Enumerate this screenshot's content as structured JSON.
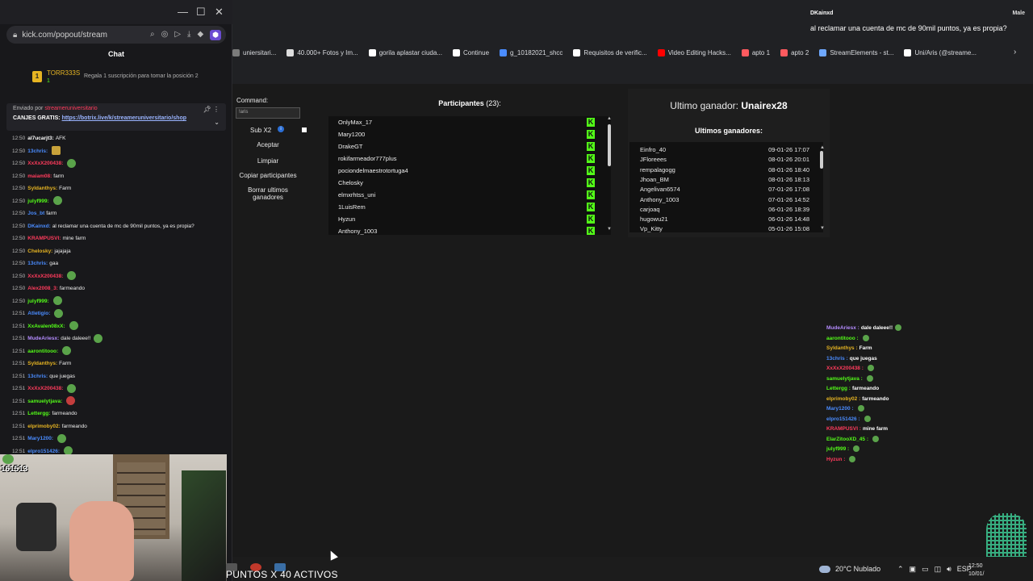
{
  "popout": {
    "url": "kick.com/popout/stream",
    "chat_title": "Chat",
    "leader": {
      "rank": "1",
      "name": "TORR333S",
      "sub": "1",
      "promo": "Regala 1 suscripción para tomar la posición 2"
    },
    "pinned": {
      "prefix": "Enviado por",
      "pinner": "streameruniversitario",
      "text": "CANJES GRATIS:",
      "link": "https://botrix.live/k/streameruniversitario/shop"
    },
    "messages": [
      {
        "t": "12:50",
        "u": "al7ucarjt3:",
        "c": "#ffffff",
        "m": "AFK",
        "e": ""
      },
      {
        "t": "12:50",
        "u": "13chris:",
        "c": "#4a8cff",
        "m": "",
        "e": "gold"
      },
      {
        "t": "12:50",
        "u": "XxXxX200438:",
        "c": "#ff3b5c",
        "m": "",
        "e": "pepe"
      },
      {
        "t": "12:50",
        "u": "maiam08:",
        "c": "#ff3b5c",
        "m": "farm",
        "e": ""
      },
      {
        "t": "12:50",
        "u": "Syldanthys:",
        "c": "#e6b422",
        "m": "Farm",
        "e": ""
      },
      {
        "t": "12:50",
        "u": "julyf999:",
        "c": "#53fc18",
        "m": "",
        "e": "pepe"
      },
      {
        "t": "12:50",
        "u": "Jos_bt",
        "c": "#4a8cff",
        "m": "farm",
        "e": ""
      },
      {
        "t": "12:50",
        "u": "DKainxd:",
        "c": "#4a8cff",
        "m": "al reclamar una cuenta de mc de 90mil puntos, ya es propia?",
        "e": ""
      },
      {
        "t": "12:50",
        "u": "KRAMPUSVI:",
        "c": "#ff3b5c",
        "m": "mine farm",
        "e": ""
      },
      {
        "t": "12:50",
        "u": "Chelosky:",
        "c": "#e6b422",
        "m": "jajajaja",
        "e": ""
      },
      {
        "t": "12:50",
        "u": "13chris:",
        "c": "#4a8cff",
        "m": "gaa",
        "e": ""
      },
      {
        "t": "12:50",
        "u": "XxXxX200438:",
        "c": "#ff3b5c",
        "m": "",
        "e": "pepe"
      },
      {
        "t": "12:50",
        "u": "Alex2008_3:",
        "c": "#ff3b5c",
        "m": "farmeando",
        "e": ""
      },
      {
        "t": "12:50",
        "u": "julyf999:",
        "c": "#53fc18",
        "m": "",
        "e": "pepe"
      },
      {
        "t": "12:51",
        "u": "Atletigio:",
        "c": "#4a8cff",
        "m": "",
        "e": "pepe"
      },
      {
        "t": "12:51",
        "u": "XxAvalen08xX:",
        "c": "#53fc18",
        "m": "",
        "e": "pepe"
      },
      {
        "t": "12:51",
        "u": "MudeAriesx:",
        "c": "#b58cff",
        "m": "dale daleee!!",
        "e": "pepe"
      },
      {
        "t": "12:51",
        "u": "aarontitooo:",
        "c": "#53fc18",
        "m": "",
        "e": "pepe"
      },
      {
        "t": "12:51",
        "u": "Syldanthys:",
        "c": "#e6b422",
        "m": "Farm",
        "e": ""
      },
      {
        "t": "12:51",
        "u": "13chris:",
        "c": "#4a8cff",
        "m": "que juegas",
        "e": ""
      },
      {
        "t": "12:51",
        "u": "XxXxX200438:",
        "c": "#ff3b5c",
        "m": "",
        "e": "pepe"
      },
      {
        "t": "12:51",
        "u": "samuelytjava:",
        "c": "#53fc18",
        "m": "",
        "e": "red"
      },
      {
        "t": "12:51",
        "u": "Lettergg:",
        "c": "#53fc18",
        "m": "farmeando",
        "e": ""
      },
      {
        "t": "12:51",
        "u": "elprimoby02:",
        "c": "#e6b422",
        "m": "farmeando",
        "e": ""
      },
      {
        "t": "12:51",
        "u": "Mary1200:",
        "c": "#4a8cff",
        "m": "",
        "e": "pepe"
      },
      {
        "t": "12:51",
        "u": "elpro151426:",
        "c": "#4a8cff",
        "m": "",
        "e": "pepe"
      }
    ],
    "cam_counter": "161513"
  },
  "notification": {
    "from": "DKainxd",
    "from2": "Male",
    "text": "al reclamar una cuenta de mc de 90mil puntos, ya es propia?"
  },
  "bookmarks": [
    {
      "label": "uniersitari...",
      "color": "#7b7b7b"
    },
    {
      "label": "40.000+ Fotos y Im...",
      "color": "#dddddd"
    },
    {
      "label": "gorila aplastar ciuda...",
      "color": "#ffffff"
    },
    {
      "label": "Continue",
      "color": "#ffffff"
    },
    {
      "label": "g_10182021_shcc",
      "color": "#4a8cff"
    },
    {
      "label": "Requisitos de verific...",
      "color": "#ffffff"
    },
    {
      "label": "Video Editing Hacks...",
      "color": "#ff0000"
    },
    {
      "label": "apto 1",
      "color": "#ff5a5f"
    },
    {
      "label": "apto 2",
      "color": "#ff5a5f"
    },
    {
      "label": "StreamElements - st...",
      "color": "#6ea8ff"
    },
    {
      "label": "Uni/Aris (@streame...",
      "color": "#ffffff"
    }
  ],
  "command_panel": {
    "label": "Command:",
    "value": "!aris",
    "subx2": "Sub X2",
    "accept": "Aceptar",
    "clear": "Limpiar",
    "copy": "Copiar participantes",
    "delete": "Borrar ultimos ganadores"
  },
  "participants": {
    "title": "Participantes",
    "count": "(23):",
    "items": [
      "OnlyMax_17",
      "Mary1200",
      "DrakeGT",
      "rokifarmeador777plus",
      "pociondelmaestrotortuga4",
      "Chelosky",
      "elmxrhtss_uni",
      "1LuisRem",
      "Hyzun",
      "Anthony_1003"
    ]
  },
  "winners": {
    "last_label": "Ultimo ganador:",
    "last_name": "Unairex28",
    "title": "Ultimos ganadores:",
    "items": [
      {
        "name": "Einfro_40",
        "date": "09-01-26 17:07"
      },
      {
        "name": "JFloreees",
        "date": "08-01-26 20:01"
      },
      {
        "name": "rempalagogg",
        "date": "08-01-26 18:40"
      },
      {
        "name": "Jhoan_BM",
        "date": "08-01-26 18:13"
      },
      {
        "name": "Angelivan6574",
        "date": "07-01-26 17:08"
      },
      {
        "name": "Anthony_1003",
        "date": "07-01-26 14:52"
      },
      {
        "name": "carjoaq",
        "date": "06-01-26 18:39"
      },
      {
        "name": "hugowu21",
        "date": "06-01-26 14:48"
      },
      {
        "name": "Vp_Kitty",
        "date": "05-01-26 15:08"
      }
    ]
  },
  "overlay_chat": [
    {
      "n": "MudeAriesx :",
      "c": "#b58cff",
      "m": "dale daleee!!",
      "e": true
    },
    {
      "n": "aarontitooo :",
      "c": "#53fc18",
      "m": "",
      "e": true
    },
    {
      "n": "Syldanthys :",
      "c": "#e6b422",
      "m": "Farm",
      "e": false
    },
    {
      "n": "13chris :",
      "c": "#4a8cff",
      "m": "que juegas",
      "e": false
    },
    {
      "n": "XxXxX200438 :",
      "c": "#ff3b5c",
      "m": "",
      "e": true
    },
    {
      "n": "samuelytjava :",
      "c": "#53fc18",
      "m": "",
      "e": true
    },
    {
      "n": "Lettergg :",
      "c": "#53fc18",
      "m": "farmeando",
      "e": false
    },
    {
      "n": "elprimoby02 :",
      "c": "#e6b422",
      "m": "farmeando",
      "e": false
    },
    {
      "n": "Mary1200 :",
      "c": "#4a8cff",
      "m": "",
      "e": true
    },
    {
      "n": "elpro151426 :",
      "c": "#4a8cff",
      "m": "",
      "e": true
    },
    {
      "n": "KRAMPUSVI :",
      "c": "#ff3b5c",
      "m": "mine farm",
      "e": false
    },
    {
      "n": "ElarZitooXD_45 :",
      "c": "#53fc18",
      "m": "",
      "e": true
    },
    {
      "n": "julyf999 :",
      "c": "#53fc18",
      "m": "",
      "e": true
    },
    {
      "n": "Hyzun :",
      "c": "#ff3b5c",
      "m": "",
      "e": true
    }
  ],
  "taskbar": {
    "ticker": "PUNTOS X 40 ACTIVOS",
    "weather": "20°C Nublado",
    "lang": "ESP",
    "time": "12:50",
    "date": "10/01/"
  }
}
